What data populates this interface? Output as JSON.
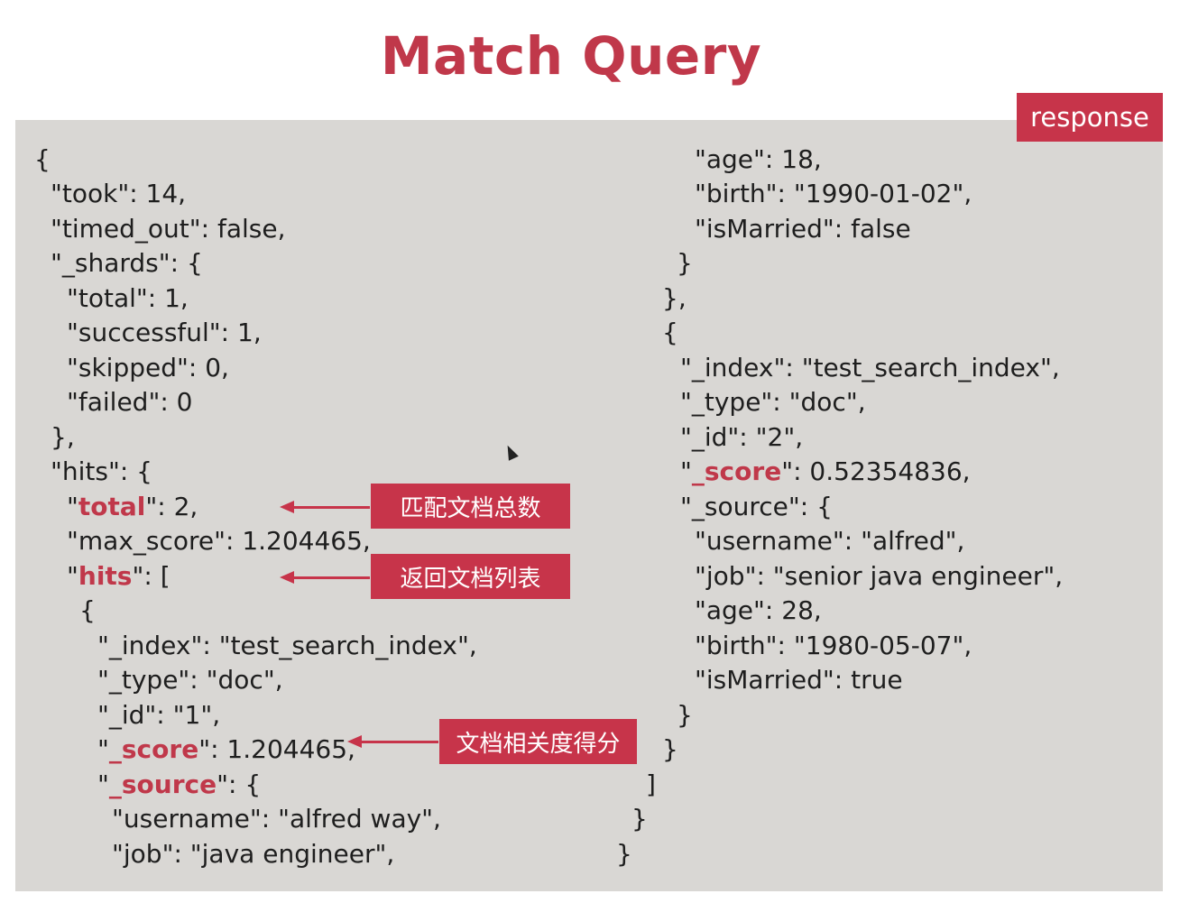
{
  "title": "Match Query",
  "tag": "response",
  "callouts": {
    "total": "匹配文档总数",
    "hits": "返回文档列表",
    "score": "文档相关度得分"
  },
  "left": {
    "l1": "{",
    "l2": "\"took\": 14,",
    "l3": "\"timed_out\": false,",
    "l4": "\"_shards\": {",
    "l5": "\"total\": 1,",
    "l6": "\"successful\": 1,",
    "l7": "\"skipped\": 0,",
    "l8": "\"failed\": 0",
    "l9": "},",
    "l10": "\"hits\": {",
    "l11a": "\"",
    "l11b": "total",
    "l11c": "\": 2,",
    "l12": "\"max_score\": 1.204465,",
    "l13a": "\"",
    "l13b": "hits",
    "l13c": "\": [",
    "l14": "{",
    "l15": "\"_index\": \"test_search_index\",",
    "l16": "\"_type\": \"doc\",",
    "l17": "\"_id\": \"1\",",
    "l18a": "\"",
    "l18b": "_score",
    "l18c": "\": 1.204465,",
    "l19a": "\"",
    "l19b": "_source",
    "l19c": "\": {",
    "l20": "\"username\": \"alfred way\",",
    "l21": "\"job\": \"java engineer\","
  },
  "right": {
    "r1": "\"age\": 18,",
    "r2": "\"birth\": \"1990-01-02\",",
    "r3": "\"isMarried\": false",
    "r4": "}",
    "r5": "},",
    "r6": "{",
    "r7": "\"_index\": \"test_search_index\",",
    "r8": "\"_type\": \"doc\",",
    "r9": "\"_id\": \"2\",",
    "r10a": "\"",
    "r10b": "_score",
    "r10c": "\": 0.52354836,",
    "r11": "\"_source\": {",
    "r12": "\"username\": \"alfred\",",
    "r13": "\"job\": \"senior java engineer\",",
    "r14": "\"age\": 28,",
    "r15": "\"birth\": \"1980-05-07\",",
    "r16": "\"isMarried\": true",
    "r17": "}",
    "r18": "}",
    "r19": "]",
    "r20": "}",
    "r21": "}"
  }
}
